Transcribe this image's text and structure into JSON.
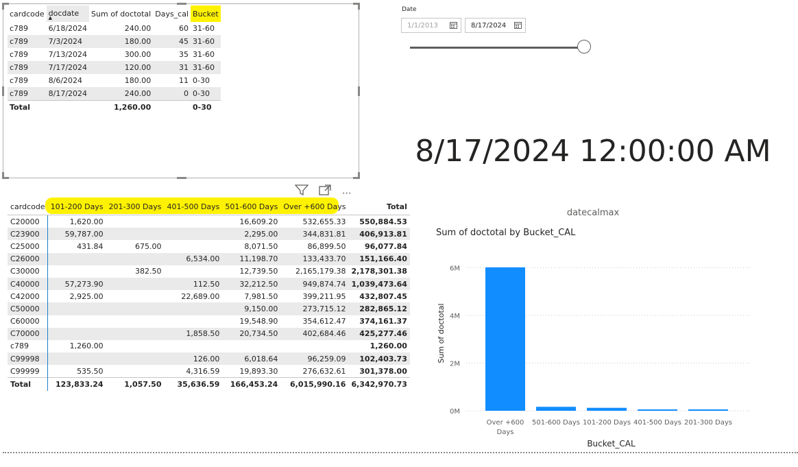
{
  "top_table": {
    "columns": [
      "cardcode",
      "docdate",
      "Sum of doctotal",
      "Days_cal",
      "Bucket"
    ],
    "rows": [
      [
        "c789",
        "6/18/2024",
        "240.00",
        "60",
        "31-60"
      ],
      [
        "c789",
        "7/3/2024",
        "180.00",
        "45",
        "31-60"
      ],
      [
        "c789",
        "7/13/2024",
        "300.00",
        "35",
        "31-60"
      ],
      [
        "c789",
        "7/17/2024",
        "120.00",
        "31",
        "31-60"
      ],
      [
        "c789",
        "8/6/2024",
        "180.00",
        "11",
        "0-30"
      ],
      [
        "c789",
        "8/17/2024",
        "240.00",
        "0",
        "0-30"
      ]
    ],
    "total": [
      "Total",
      "",
      "1,260.00",
      "",
      "0-30"
    ],
    "highlighted_column": "Bucket",
    "sorted_column": "docdate",
    "sort_icon": "sort-ascending-icon"
  },
  "toolbar": {
    "icons": [
      "filter-icon",
      "focus-mode-icon",
      "more-options-icon"
    ]
  },
  "matrix": {
    "columns": [
      "cardcode",
      "101-200 Days",
      "201-300 Days",
      "401-500 Days",
      "501-600 Days",
      "Over +600 Days",
      "Total"
    ],
    "rows": [
      [
        "C20000",
        "1,620.00",
        "",
        "",
        "16,609.20",
        "532,655.33",
        "550,884.53"
      ],
      [
        "C23900",
        "59,787.00",
        "",
        "",
        "2,295.00",
        "344,831.81",
        "406,913.81"
      ],
      [
        "C25000",
        "431.84",
        "675.00",
        "",
        "8,071.50",
        "86,899.50",
        "96,077.84"
      ],
      [
        "C26000",
        "",
        "",
        "6,534.00",
        "11,198.70",
        "133,433.70",
        "151,166.40"
      ],
      [
        "C30000",
        "",
        "382.50",
        "",
        "12,739.50",
        "2,165,179.38",
        "2,178,301.38"
      ],
      [
        "C40000",
        "57,273.90",
        "",
        "112.50",
        "32,212.50",
        "949,874.74",
        "1,039,473.64"
      ],
      [
        "C42000",
        "2,925.00",
        "",
        "22,689.00",
        "7,981.50",
        "399,211.95",
        "432,807.45"
      ],
      [
        "C50000",
        "",
        "",
        "",
        "9,150.00",
        "273,715.12",
        "282,865.12"
      ],
      [
        "C60000",
        "",
        "",
        "",
        "19,548.90",
        "354,612.47",
        "374,161.37"
      ],
      [
        "C70000",
        "",
        "",
        "1,858.50",
        "20,734.50",
        "402,684.46",
        "425,277.46"
      ],
      [
        "c789",
        "1,260.00",
        "",
        "",
        "",
        "",
        "1,260.00"
      ],
      [
        "C99998",
        "",
        "",
        "126.00",
        "6,018.64",
        "96,259.09",
        "102,403.73"
      ],
      [
        "C99999",
        "535.50",
        "",
        "4,316.59",
        "19,893.30",
        "276,632.61",
        "301,378.00"
      ]
    ],
    "total": [
      "Total",
      "123,833.24",
      "1,057.50",
      "35,636.59",
      "166,453.24",
      "6,015,990.16",
      "6,342,970.73"
    ]
  },
  "slicer": {
    "title": "Date",
    "start_placeholder": "1/1/2013",
    "end_value": "8/17/2024",
    "calendar_icon": "calendar-icon",
    "slider_position": 1.0
  },
  "card": {
    "value": "8/17/2024 12:00:00 AM",
    "label": "datecalmax"
  },
  "chart_data": {
    "type": "bar",
    "title": "Sum of doctotal by Bucket_CAL",
    "xlabel": "Bucket_CAL",
    "ylabel": "Sum of doctotal",
    "categories": [
      "Over +600 Days",
      "501-600 Days",
      "101-200 Days",
      "401-500 Days",
      "201-300 Days"
    ],
    "values": [
      6015990.16,
      166453.24,
      123833.24,
      35636.59,
      1057.5
    ],
    "ylim": [
      0,
      6500000
    ],
    "yticks": [
      0,
      2000000,
      4000000,
      6000000
    ],
    "ytick_labels": [
      "0M",
      "2M",
      "4M",
      "6M"
    ],
    "grid": true,
    "bar_color": "#118dff"
  },
  "colors": {
    "highlight": "#fff200",
    "accent": "#118dff",
    "row_alt": "#eaeaea"
  }
}
